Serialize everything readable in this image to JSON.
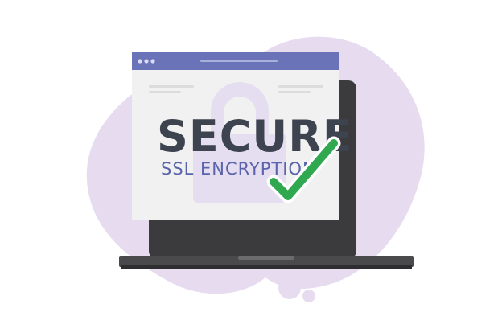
{
  "illustration": {
    "headline": "SECURE",
    "subline": "SSL ENCRYPTION",
    "icons": [
      "blob-background",
      "laptop",
      "browser-window",
      "padlock-icon",
      "checkmark-icon"
    ],
    "colors": {
      "blob": "#e7dcef",
      "laptop_body": "#3b3b3d",
      "laptop_base": "#4a4a4c",
      "browser_bar": "#6a72b8",
      "browser_page": "#f1f1f1",
      "padlock": "#e5def0",
      "headline_text": "#3e4350",
      "subline_text": "#5a63ab",
      "check": "#2fa84f",
      "check_outline": "#ffffff"
    }
  }
}
